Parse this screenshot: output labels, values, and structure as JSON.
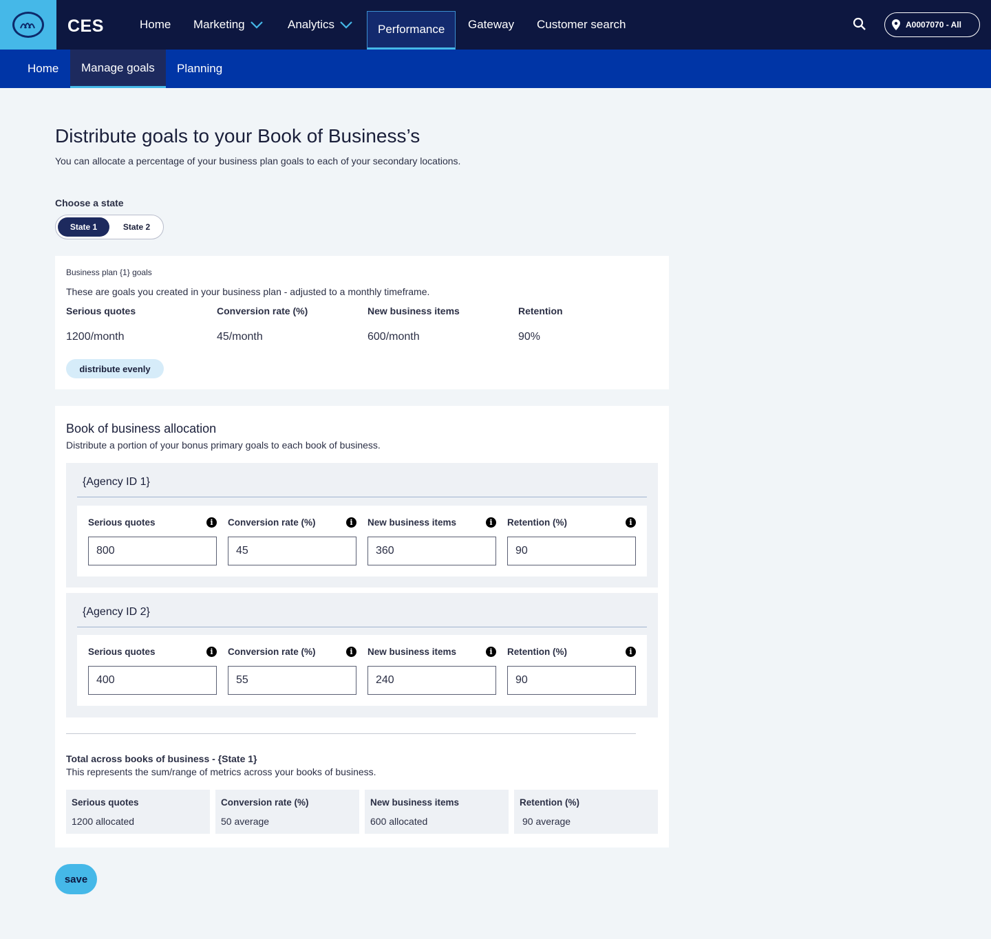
{
  "header": {
    "app_name": "CES",
    "nav": [
      {
        "label": "Home"
      },
      {
        "label": "Marketing"
      },
      {
        "label": "Analytics"
      },
      {
        "label": "Performance"
      },
      {
        "label": "Gateway"
      },
      {
        "label": "Customer search"
      }
    ],
    "agent_label": "A0007070 - All"
  },
  "subnav": [
    {
      "label": "Home"
    },
    {
      "label": "Manage goals"
    },
    {
      "label": "Planning"
    }
  ],
  "page": {
    "title": "Distribute goals to your Book of Business’s",
    "subtitle": "You can allocate a percentage of your business plan goals to each of your secondary locations."
  },
  "state_picker": {
    "label": "Choose a state",
    "options": [
      "State 1",
      "State 2"
    ],
    "selected": "State 1"
  },
  "goals": {
    "small_title": "Business plan {1} goals",
    "description": "These are goals you created in your business plan - adjusted to a monthly timeframe.",
    "items": [
      {
        "label": "Serious quotes",
        "value": "1200/month"
      },
      {
        "label": "Conversion rate (%)",
        "value": "45/month"
      },
      {
        "label": "New business items",
        "value": "600/month"
      },
      {
        "label": "Retention",
        "value": "90%"
      }
    ],
    "distribute_label": "distribute evenly"
  },
  "allocation": {
    "title": "Book of business allocation",
    "description": "Distribute a portion of your bonus primary goals to each book of business.",
    "agencies": [
      {
        "name": "{Agency ID 1}",
        "fields": [
          {
            "label": "Serious quotes",
            "value": "800"
          },
          {
            "label": "Conversion rate (%)",
            "value": "45"
          },
          {
            "label": "New business items",
            "value": "360"
          },
          {
            "label": "Retention (%)",
            "value": "90"
          }
        ]
      },
      {
        "name": "{Agency ID 2}",
        "fields": [
          {
            "label": "Serious quotes",
            "value": "400"
          },
          {
            "label": "Conversion rate (%)",
            "value": "55"
          },
          {
            "label": "New business items",
            "value": "240"
          },
          {
            "label": "Retention (%)",
            "value": "90"
          }
        ]
      }
    ],
    "total": {
      "title": "Total across books of business - {State 1}",
      "description": "This represents the sum/range of metrics across your books of business.",
      "items": [
        {
          "label": "Serious quotes",
          "value": "1200 allocated"
        },
        {
          "label": "Conversion rate (%)",
          "value": "50 average"
        },
        {
          "label": "New business items",
          "value": "600 allocated"
        },
        {
          "label": "Retention (%)",
          "value": "90 average"
        }
      ]
    }
  },
  "save_label": "save",
  "info_glyph": "i",
  "colors": {
    "top_nav": "#0d1740",
    "sub_nav": "#0035a6",
    "accent": "#45b8e8",
    "selected": "#1d2a5e"
  }
}
